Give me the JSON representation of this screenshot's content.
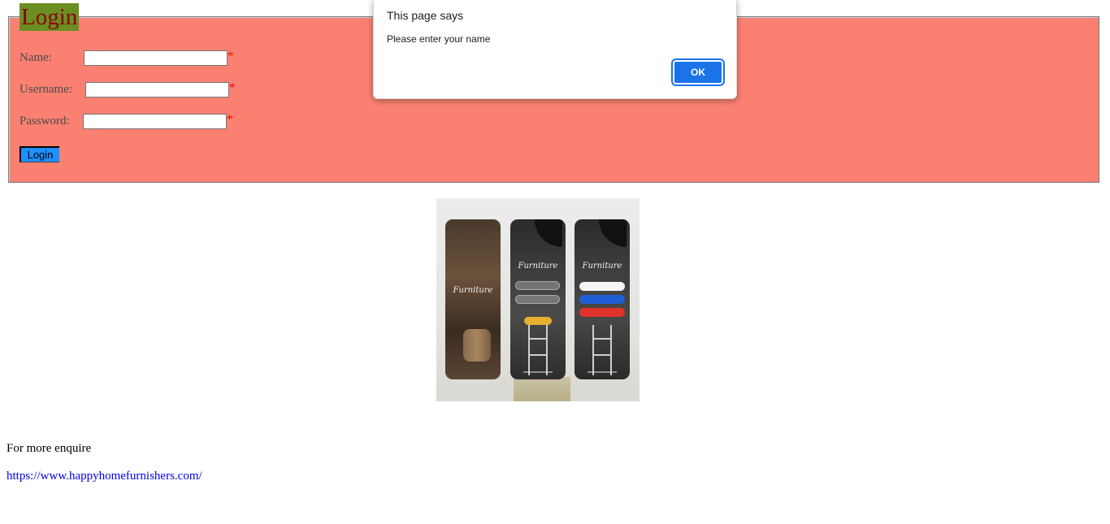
{
  "login_form": {
    "legend": "Login",
    "fields": [
      {
        "label": "Name:",
        "value": "",
        "required_mark": "*"
      },
      {
        "label": "Username:",
        "value": "",
        "required_mark": "*"
      },
      {
        "label": "Password:",
        "value": "",
        "required_mark": "*"
      }
    ],
    "submit_label": "Login"
  },
  "alert": {
    "title": "This page says",
    "message": "Please enter your name",
    "ok_label": "OK"
  },
  "footer": {
    "enquire_text": "For more enquire",
    "link_text": "https://www.happyhomefurnishers.com/"
  },
  "colors": {
    "fieldset_background": "#fa8072",
    "legend_background": "#6b8e23",
    "legend_text": "#8b0000",
    "login_button": "#1e90ff",
    "alert_ok": "#1a73e8",
    "required_star": "#ff0000",
    "link": "#0000ee"
  }
}
